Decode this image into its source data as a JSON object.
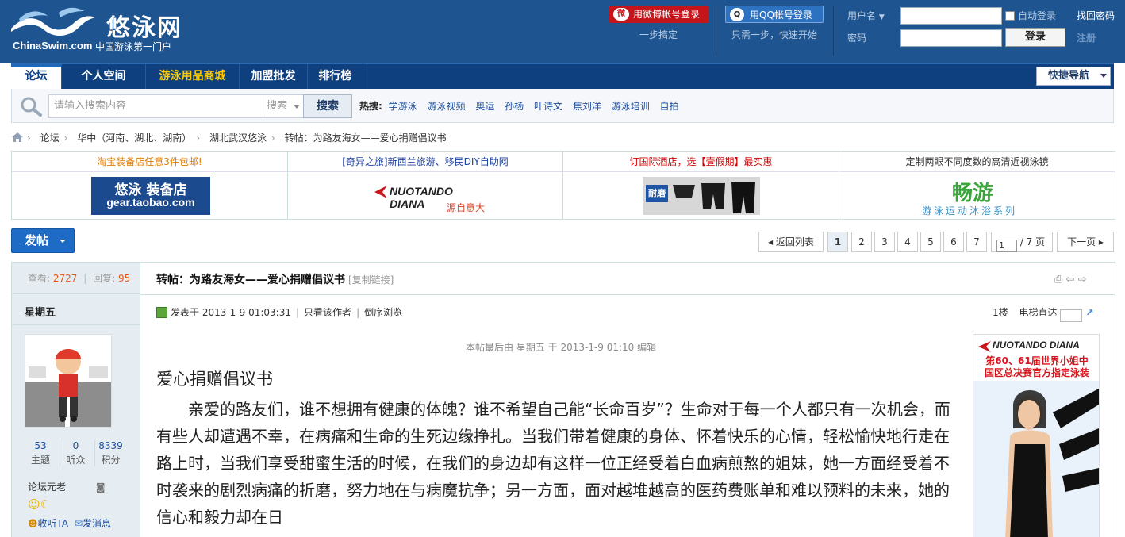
{
  "header": {
    "logo_cn": "悠泳网",
    "logo_en": "ChinaSwim.com",
    "logo_slogan": "中国游泳第一门户",
    "weibo_label": "用微博帐号登录",
    "weibo_sub": "一步搞定",
    "qq_label": "用QQ帐号登录",
    "qq_sub": "只需一步，快速开始",
    "username_label": "用户名",
    "password_label": "密码",
    "autologin_label": "自动登录",
    "forgot_label": "找回密码",
    "register_label": "注册",
    "login_label": "登录"
  },
  "nav": {
    "items": [
      "论坛",
      "个人空间",
      "游泳用品商城",
      "加盟批发",
      "排行榜"
    ],
    "quick_label": "快捷导航"
  },
  "search": {
    "placeholder": "请输入搜索内容",
    "select": "搜索",
    "button": "搜索",
    "hot_label": "热搜:",
    "hot": [
      "学游泳",
      "游泳视频",
      "奥运",
      "孙杨",
      "叶诗文",
      "焦刘洋",
      "游泳培训",
      "自拍"
    ]
  },
  "breadcrumb": [
    "论坛",
    "华中（河南、湖北、湖南）",
    "湖北武汉悠泳",
    "转帖：为路友海女——爱心捐赠倡议书"
  ],
  "ads": {
    "titles": [
      "淘宝装备店任意3件包邮!",
      "[奇异之旅]新西兰旅游、移民DIY自助网",
      "订国际酒店，选【壹假期】最实惠",
      "定制两眼不同度数的高清近视泳镜"
    ],
    "title_colors": [
      "#e07b00",
      "#1d3fa0",
      "#d40000",
      "#333333"
    ],
    "gear_text": "悠泳 装备店",
    "gear_url": "gear.taobao.com",
    "diana_text": "NUOTANDO DIANA",
    "diana_sub": "源自意大",
    "naike_text": "耐磨",
    "changyou_text": "畅游",
    "changyou_sub": "游泳运动沐浴系列"
  },
  "pager": {
    "post_label": "发帖",
    "back_label": "返回列表",
    "pages": [
      "1",
      "2",
      "3",
      "4",
      "5",
      "6",
      "7"
    ],
    "current": "1",
    "total": "/ 7 页",
    "next_label": "下一页"
  },
  "thread": {
    "views_label": "查看:",
    "views": "2727",
    "replies_label": "回复:",
    "replies": "95",
    "title": "转帖：为路友海女——爱心捐赠倡议书",
    "copy_link": "[复制链接]",
    "author": "星期五",
    "stats": [
      {
        "v": "53",
        "l": "主题"
      },
      {
        "v": "0",
        "l": "听众"
      },
      {
        "v": "8339",
        "l": "积分"
      }
    ],
    "rank": "论坛元老",
    "follow_label": "收听TA",
    "message_label": "发消息",
    "posted": "发表于 2013-1-9 01:03:31",
    "only_author": "只看该作者",
    "reverse": "倒序浏览",
    "floor": "1楼",
    "jump_label": "电梯直达",
    "edited": "本帖最后由 星期五 于 2013-1-9 01:10 编辑",
    "body_title": "爱心捐赠倡议书",
    "body": "亲爱的路友们，谁不想拥有健康的体魄？谁不希望自己能“长命百岁”？生命对于每一个人都只有一次机会，而有些人却遭遇不幸，在病痛和生命的生死边缘挣扎。当我们带着健康的身体、怀着快乐的心情，轻松愉快地行走在路上时，当我们享受甜蜜生活的时候，在我们的身边却有这样一位正经受着白血病煎熬的姐妹，她一方面经受着不时袭来的剧烈病痛的折磨，努力地在与病魔抗争；另一方面，面对越堆越高的医药费账单和难以预料的未来，她的信心和毅力却在日",
    "sidead_brand": "NUOTANDO DIANA",
    "sidead_text": "第60、61届世界小姐中国区总决赛官方指定泳装"
  }
}
